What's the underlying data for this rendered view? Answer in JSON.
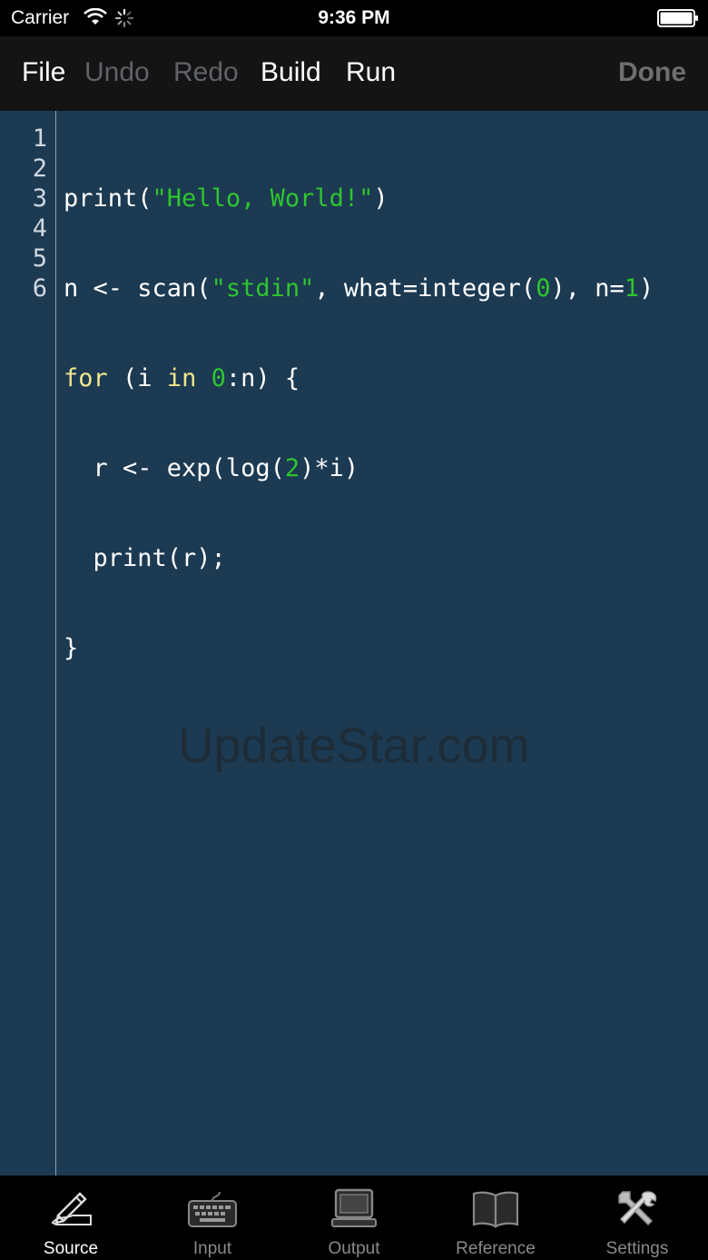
{
  "status": {
    "carrier": "Carrier",
    "time": "9:36 PM",
    "icons": [
      "wifi-icon",
      "activity-spinner-icon",
      "battery-icon"
    ]
  },
  "toolbar": {
    "file": "File",
    "undo": "Undo",
    "redo": "Redo",
    "build": "Build",
    "run": "Run",
    "done": "Done"
  },
  "editor": {
    "line_numbers": [
      "1",
      "2",
      "3",
      "4",
      "5",
      "6"
    ],
    "lines": [
      "print(\"Hello, World!\")",
      "n <- scan(\"stdin\", what=integer(0), n=1)",
      "for (i in 0:n) {",
      "  r <- exp(log(2)*i)",
      "  print(r);",
      "}"
    ],
    "colors": {
      "background": "#1c3a52",
      "string": "#2fc52f",
      "keyword": "#f0e68c",
      "number": "#2fc52f"
    }
  },
  "watermark": "UpdateStar.com",
  "tabs": [
    {
      "label": "Source",
      "icon": "pen-icon",
      "active": true
    },
    {
      "label": "Input",
      "icon": "keyboard-icon",
      "active": false
    },
    {
      "label": "Output",
      "icon": "computer-icon",
      "active": false
    },
    {
      "label": "Reference",
      "icon": "book-icon",
      "active": false
    },
    {
      "label": "Settings",
      "icon": "tools-icon",
      "active": false
    }
  ]
}
